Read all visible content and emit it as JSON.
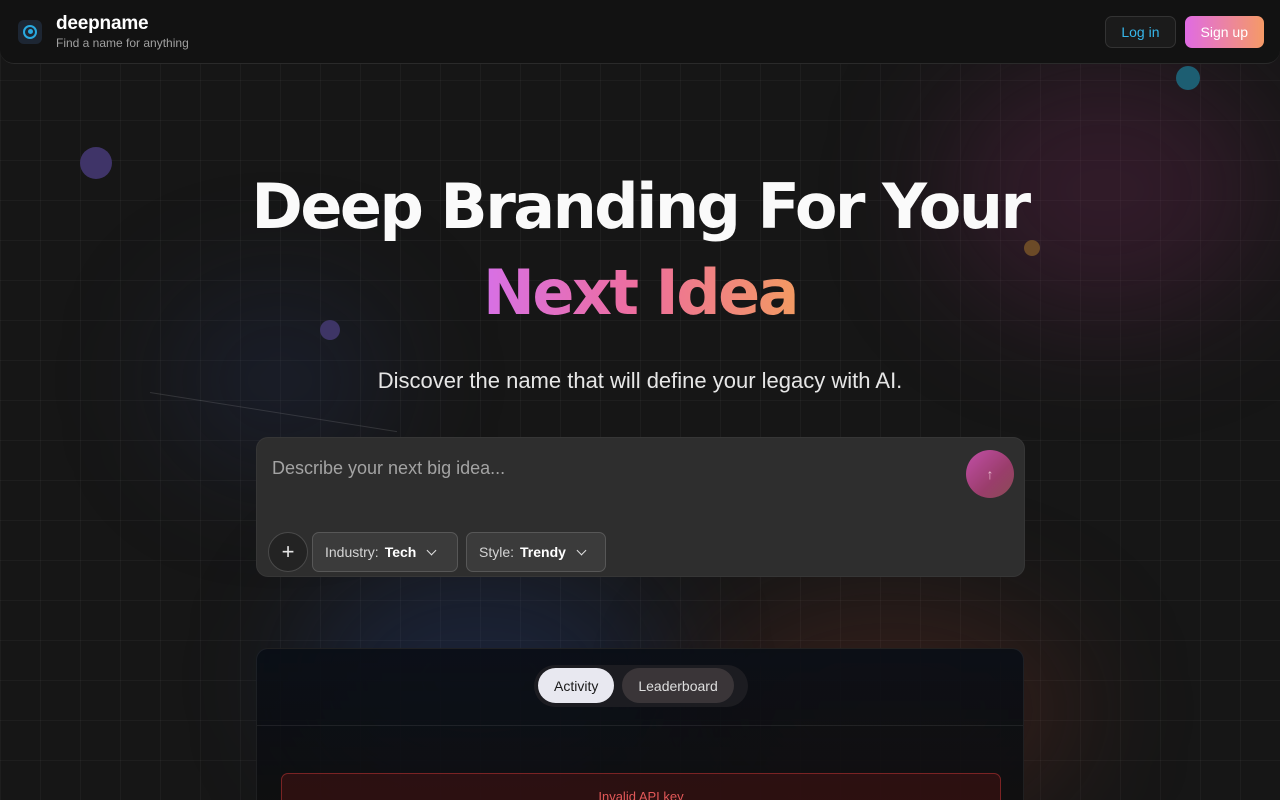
{
  "brand": {
    "name": "deepname",
    "tagline": "Find a name for anything",
    "logo_icon": "target-logo-icon"
  },
  "auth": {
    "login_label": "Log in",
    "signup_label": "Sign up"
  },
  "hero": {
    "title_line1": "Deep Branding For Your",
    "title_line2": "Next Idea",
    "subtitle": "Discover the name that will define your legacy with AI."
  },
  "prompt": {
    "placeholder": "Describe your next big idea...",
    "value": "",
    "send_icon": "arrow-up-icon",
    "add_icon": "plus-icon",
    "filters": [
      {
        "label": "Industry:",
        "value": "Tech"
      },
      {
        "label": "Style:",
        "value": "Trendy"
      }
    ]
  },
  "activity": {
    "tabs": [
      {
        "label": "Activity",
        "active": true
      },
      {
        "label": "Leaderboard",
        "active": false
      }
    ],
    "error_message": "Invalid API key"
  },
  "colors": {
    "accent_blue": "#36b6ea",
    "gradient_start": "#d770e6",
    "gradient_end": "#f29a62",
    "error": "#e25858"
  }
}
